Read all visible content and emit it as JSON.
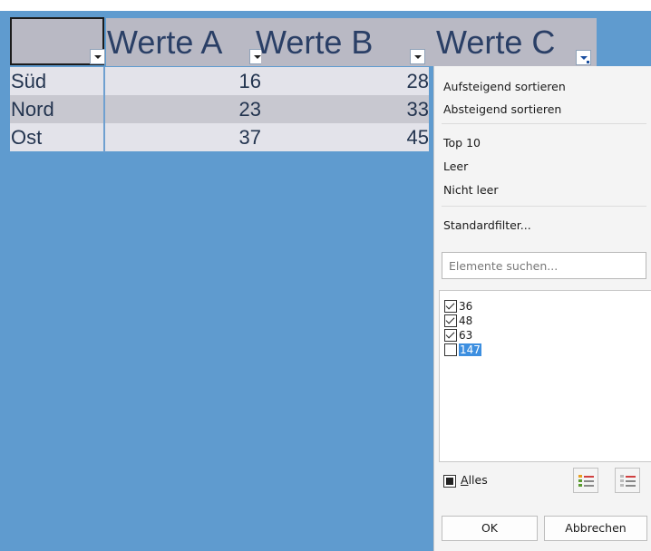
{
  "headers": {
    "col_a": "Werte A",
    "col_b": "Werte B",
    "col_c": "Werte C"
  },
  "rows": [
    {
      "label": "Süd",
      "a": "16",
      "b": "28"
    },
    {
      "label": "Nord",
      "a": "23",
      "b": "33"
    },
    {
      "label": "Ost",
      "a": "37",
      "b": "45"
    }
  ],
  "filter_popup": {
    "sort_asc": "Aufsteigend sortieren",
    "sort_desc": "Absteigend sortieren",
    "top10": "Top 10",
    "empty": "Leer",
    "not_empty": "Nicht leer",
    "standard_filter": "Standardfilter...",
    "search_placeholder": "Elemente suchen...",
    "values": [
      {
        "label": "36",
        "checked": true,
        "selected": false
      },
      {
        "label": "48",
        "checked": true,
        "selected": false
      },
      {
        "label": "63",
        "checked": true,
        "selected": false
      },
      {
        "label": "147",
        "checked": false,
        "selected": true
      }
    ],
    "all_label_prefix": "A",
    "all_label_rest": "lles",
    "all_state": "indeterminate",
    "check_all_icon": "select-all-icon",
    "uncheck_all_icon": "unselect-all-icon",
    "ok_label": "OK",
    "cancel_label": "Abbrechen"
  },
  "colors": {
    "sheet_background": "#5f9bcf",
    "header_fill": "#b9b9c4",
    "header_text": "#2a3f66",
    "selection": "#3d8fe0"
  }
}
